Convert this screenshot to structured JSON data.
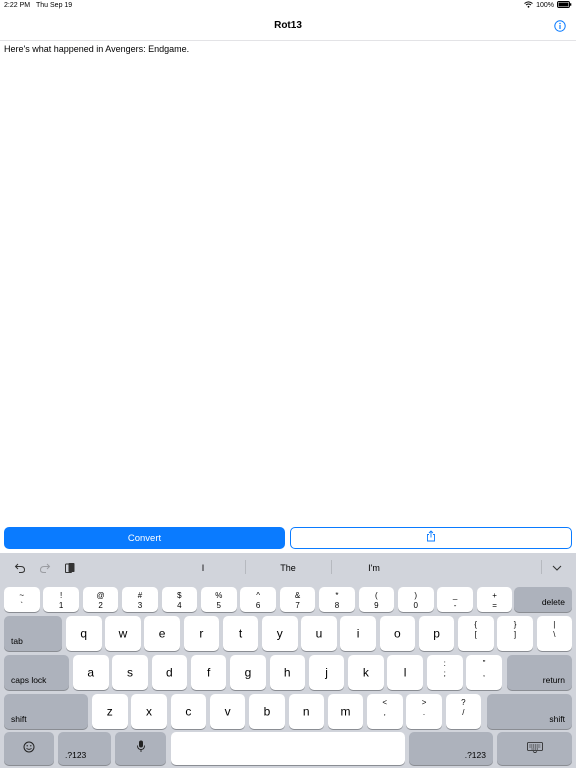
{
  "status": {
    "time": "2:22 PM",
    "date": "Thu Sep 19",
    "battery": "100%"
  },
  "navbar": {
    "title": "Rot13"
  },
  "editor": {
    "text": "Here's what happened in Avengers: Endgame."
  },
  "actions": {
    "convert_label": "Convert"
  },
  "suggestions": [
    "I",
    "The",
    "I'm"
  ],
  "keyboard": {
    "row1": [
      {
        "t": "~",
        "b": "`"
      },
      {
        "t": "!",
        "b": "1"
      },
      {
        "t": "@",
        "b": "2"
      },
      {
        "t": "#",
        "b": "3"
      },
      {
        "t": "$",
        "b": "4"
      },
      {
        "t": "%",
        "b": "5"
      },
      {
        "t": "^",
        "b": "6"
      },
      {
        "t": "&",
        "b": "7"
      },
      {
        "t": "*",
        "b": "8"
      },
      {
        "t": "(",
        "b": "9"
      },
      {
        "t": ")",
        "b": "0"
      },
      {
        "t": "_",
        "b": "-"
      },
      {
        "t": "+",
        "b": "="
      }
    ],
    "delete": "delete",
    "tab": "tab",
    "row2": [
      "q",
      "w",
      "e",
      "r",
      "t",
      "y",
      "u",
      "i",
      "o",
      "p"
    ],
    "row2_sym": [
      {
        "t": "{",
        "b": "["
      },
      {
        "t": "}",
        "b": "]"
      },
      {
        "t": "|",
        "b": "\\"
      }
    ],
    "caps": "caps lock",
    "row3": [
      "a",
      "s",
      "d",
      "f",
      "g",
      "h",
      "j",
      "k",
      "l"
    ],
    "row3_sym": [
      {
        "t": ":",
        "b": ";"
      },
      {
        "t": "\"",
        "b": ","
      }
    ],
    "return": "return",
    "shift": "shift",
    "row4": [
      "z",
      "x",
      "c",
      "v",
      "b",
      "n",
      "m"
    ],
    "row4_sym": [
      {
        "t": "<",
        "b": ","
      },
      {
        "t": ">",
        "b": "."
      },
      {
        "t": "?",
        "b": "/"
      }
    ],
    "numbers": ".?123"
  }
}
